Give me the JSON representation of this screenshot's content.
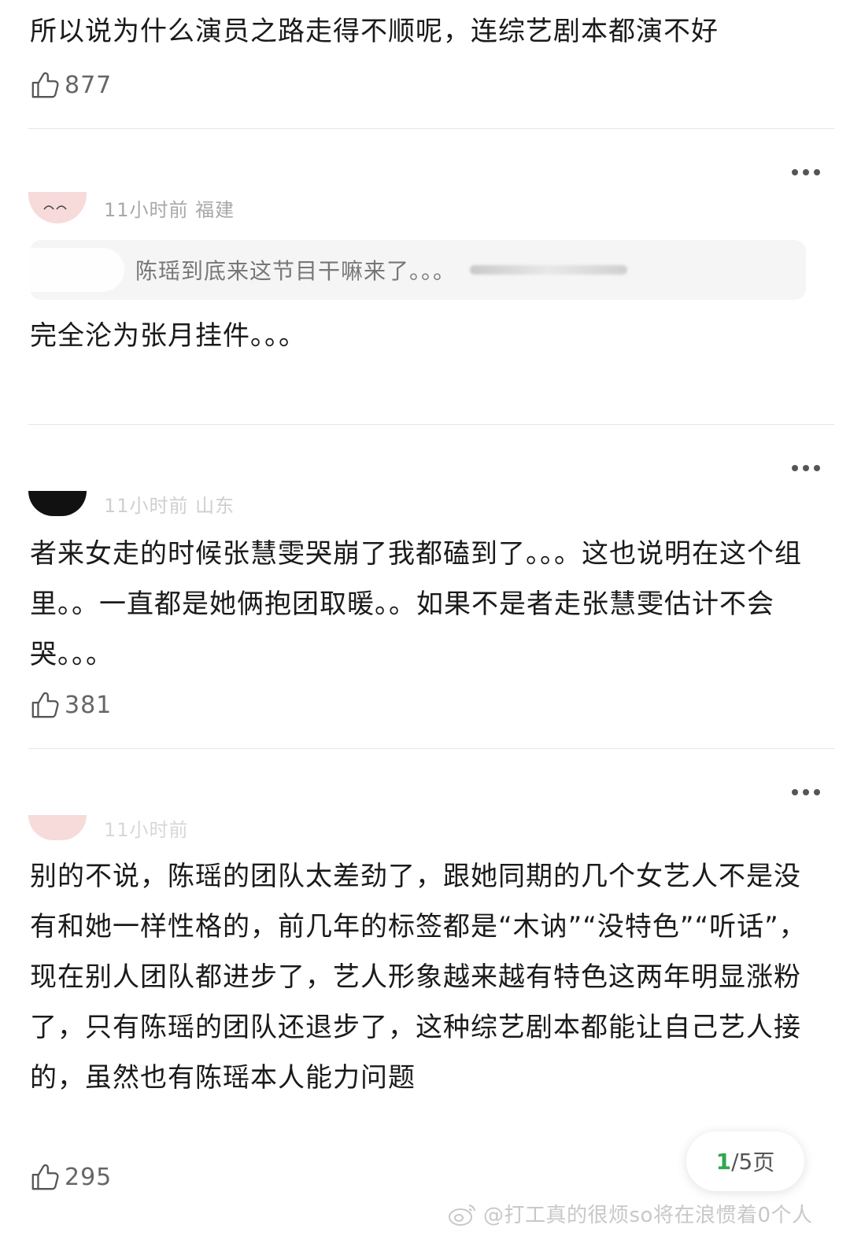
{
  "comments": [
    {
      "text": "所以说为什么演员之路走得不顺呢，连综艺剧本都演不好",
      "likes": "877"
    },
    {
      "meta": "11小时前  福建",
      "quote": "陈瑶到底来这节目干嘛来了。。。",
      "text": "完全沦为张月挂件。。。"
    },
    {
      "meta": "11小时前  山东",
      "text": "者来女走的时候张慧雯哭崩了我都磕到了。。。这也说明在这个组里。。一直都是她俩抱团取暖。。如果不是者走张慧雯估计不会哭。。。",
      "likes": "381"
    },
    {
      "meta": "11小时前",
      "text": "别的不说，陈瑶的团队太差劲了，跟她同期的几个女艺人不是没有和她一样性格的，前几年的标签都是“木讷”“没特色”“听话”，现在别人团队都进步了，艺人形象越来越有特色这两年明显涨粉了，只有陈瑶的团队还退步了，这种综艺剧本都能让自己艺人接的，虽然也有陈瑶本人能力问题",
      "likes": "295"
    }
  ],
  "pager": {
    "current": "1",
    "total": "/5",
    "unit": " 页"
  },
  "watermark": "@打工真的很烦so将在浪惯着0个人",
  "icons": [
    "thumbs-up-icon",
    "more-icon",
    "weibo-icon"
  ],
  "colors": {
    "pager_current": "#2fa84f",
    "meta": "#a8a8a8",
    "quote_bg": "#f5f5f5"
  }
}
